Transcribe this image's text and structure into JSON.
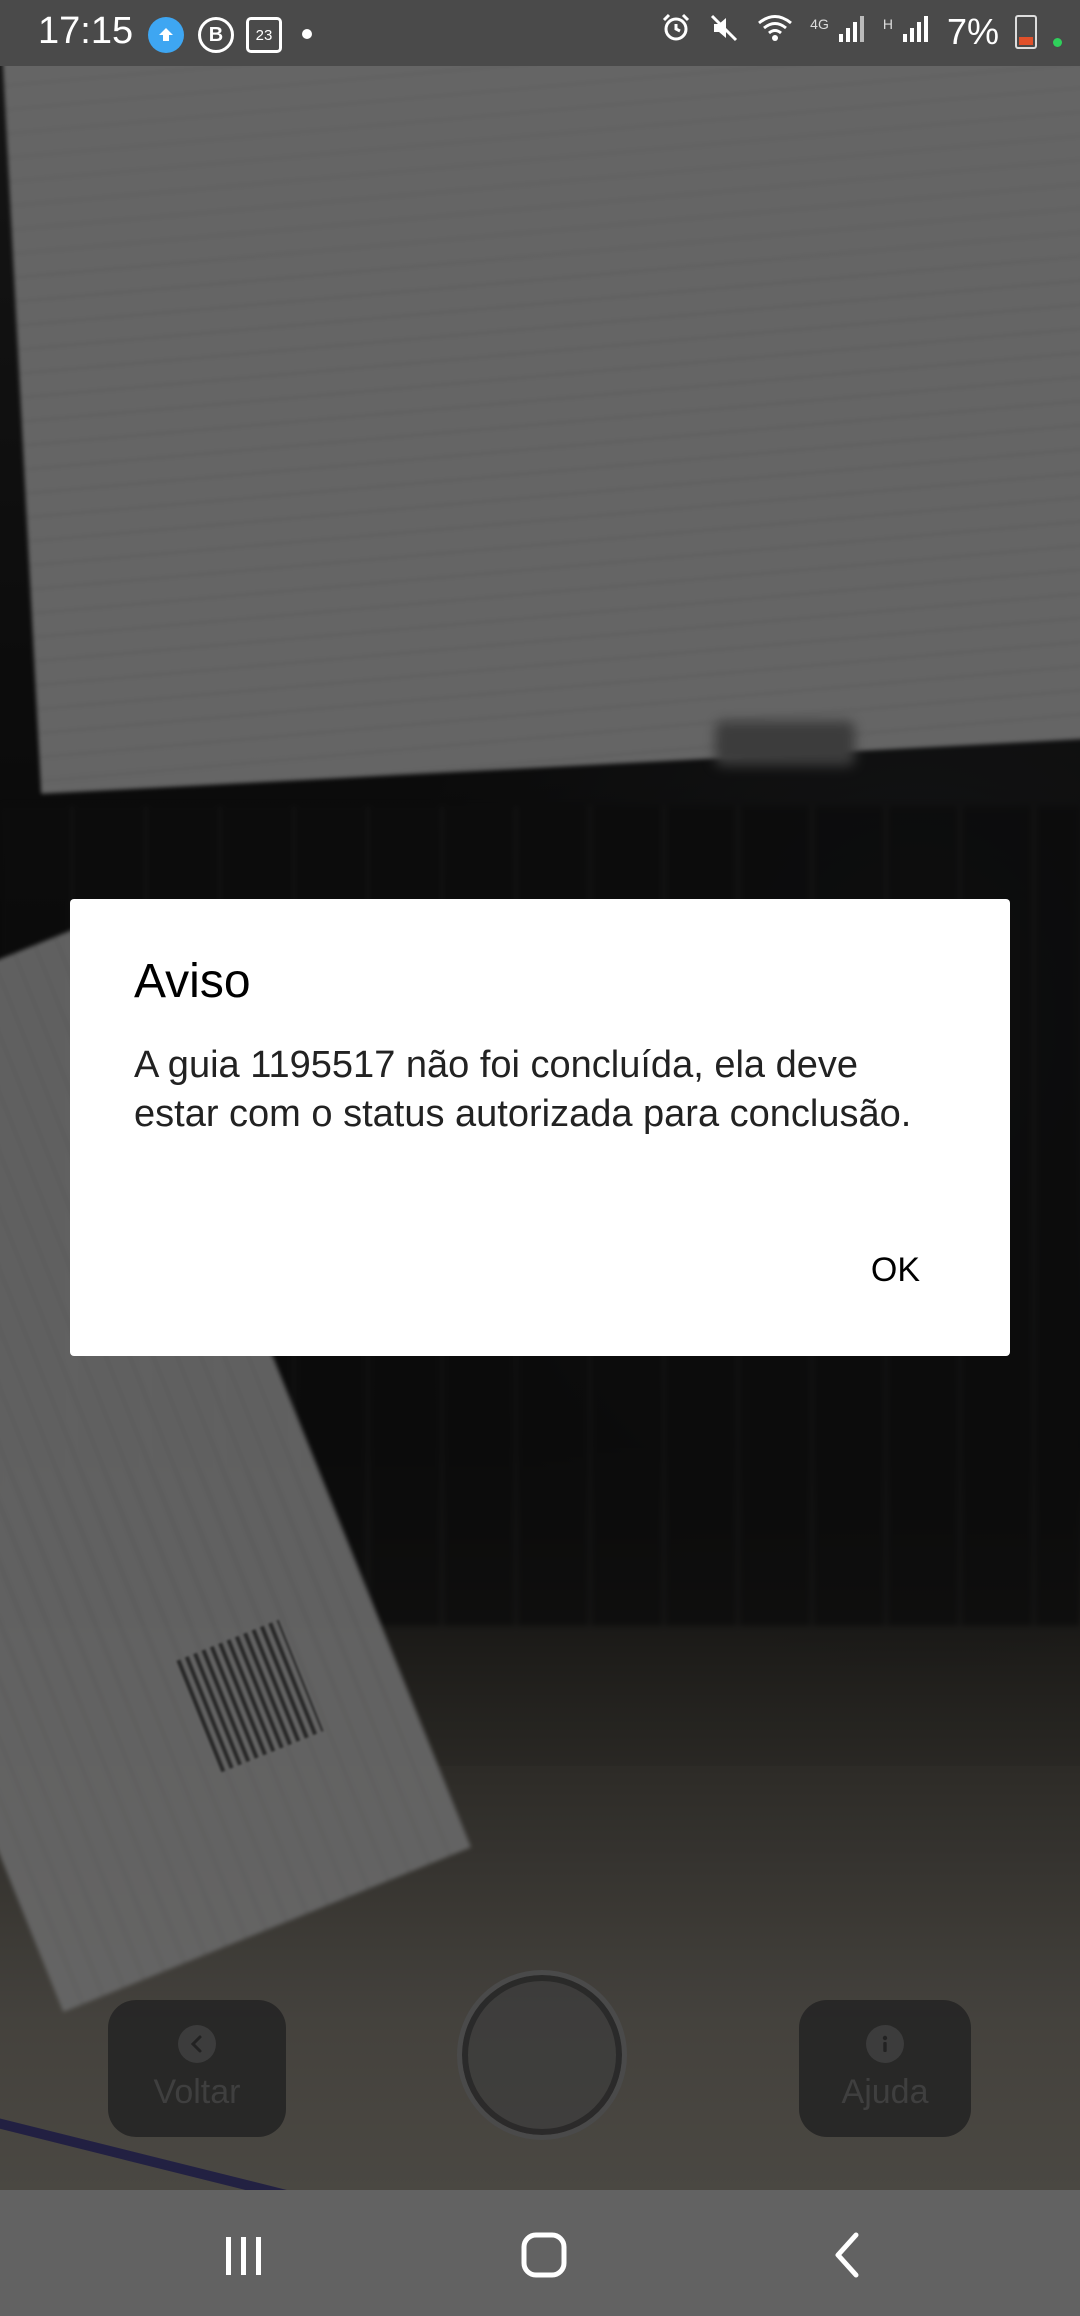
{
  "status_bar": {
    "time": "17:15",
    "calendar_day": "23",
    "network_4g": "4G",
    "network_h": "H",
    "battery_percent": "7%",
    "icons": [
      "cloud-app-icon",
      "b-app-icon",
      "calendar-icon",
      "alarm-icon",
      "mute-icon",
      "wifi-icon",
      "signal-icon",
      "battery-icon"
    ]
  },
  "dialog": {
    "title": "Aviso",
    "message": "A guia 1195517 não foi concluída, ela deve estar com o status autorizada para conclusão.",
    "ok_label": "OK"
  },
  "camera_controls": {
    "back_label": "Voltar",
    "help_label": "Ajuda",
    "back_icon": "chevron-left-icon",
    "help_icon": "info-icon"
  },
  "nav_bar": {
    "icons": [
      "recent-apps-icon",
      "home-icon",
      "back-icon"
    ]
  },
  "colors": {
    "status_bar": "#4a4a4a",
    "nav_bar": "#626262",
    "dialog_bg": "#ffffff",
    "battery_low": "#e0502a",
    "privacy_dot": "#2fd05b"
  }
}
